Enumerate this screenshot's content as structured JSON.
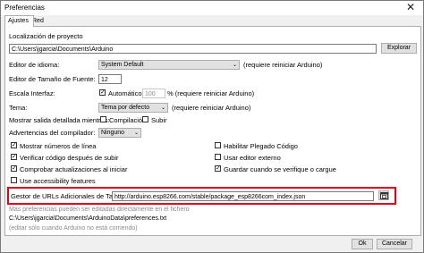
{
  "window": {
    "title": "Preferencias",
    "close_glyph": "✕"
  },
  "tabs": [
    {
      "label": "Ajustes",
      "active": true
    },
    {
      "label": "Red",
      "active": false
    }
  ],
  "sketchbook": {
    "label": "Localización de proyecto",
    "path": "C:\\Users\\jgarcia\\Documents\\Arduino",
    "browse_label": "Explorar"
  },
  "language": {
    "label": "Editor de idioma:",
    "value": "System Default",
    "note": "(requiere reiniciar Arduino)"
  },
  "font_size": {
    "label": "Editor de Tamaño de Fuente:",
    "value": "12"
  },
  "scale": {
    "label": "Escala Interfaz:",
    "auto_label": "Automático",
    "auto_checked": true,
    "value": "100",
    "note": "% (requiere reiniciar Arduino)"
  },
  "theme": {
    "label": "Tema:",
    "value": "Tema por defecto",
    "note": "(requiere reiniciar Arduino)"
  },
  "verbose": {
    "label": "Mostrar salida detallada mientras:",
    "compile_label": "Compilación",
    "upload_label": "Subir"
  },
  "warnings": {
    "label": "Advertencias del compilador:",
    "value": "Ninguno"
  },
  "options_left": [
    {
      "label": "Mostrar números de línea",
      "checked": true
    },
    {
      "label": "Verificar código después de subir",
      "checked": true
    },
    {
      "label": "Comprobar actualizaciones al iniciar",
      "checked": true
    },
    {
      "label": "Use accessibility features",
      "checked": false
    }
  ],
  "options_right": [
    {
      "label": "Habilitar Plegado Código",
      "checked": false
    },
    {
      "label": "Usar editor externo",
      "checked": false
    },
    {
      "label": "Guardar cuando se verifique o cargue",
      "checked": true
    }
  ],
  "boards_url": {
    "label": "Gestor de URLs Adicionales de Tarjetas:",
    "value": "http://arduino.esp8266.com/stable/package_esp8266com_index.json"
  },
  "more_prefs": {
    "note": "Más preferencias pueden ser editadas directamente en el fichero",
    "path": "C:\\Users\\jgarcia\\Documents\\ArduinoData\\preferences.txt",
    "edit_note": "(editar sólo cuando Arduino no está corriendo)"
  },
  "footer": {
    "ok_label": "Ok",
    "cancel_label": "Cancelar"
  },
  "colors": {
    "highlight": "#e0001a"
  }
}
